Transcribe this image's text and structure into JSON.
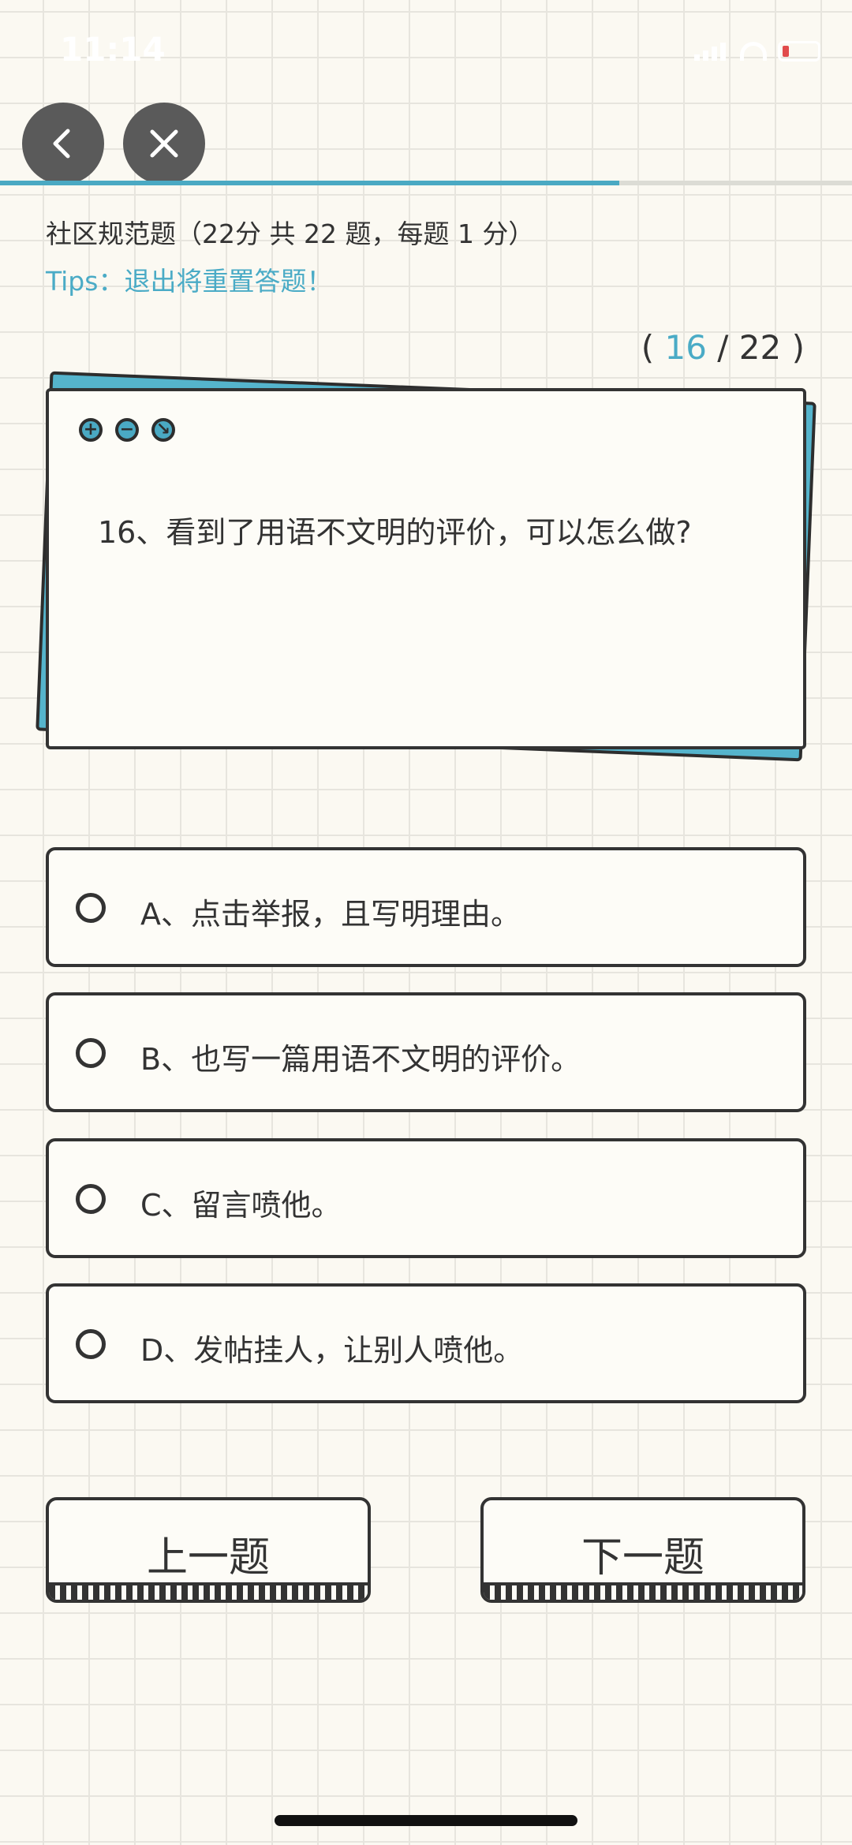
{
  "status_bar": {
    "time": "11:14"
  },
  "header": {
    "back_icon": "chevron-left-icon",
    "close_icon": "close-icon",
    "progress_fraction": 0.727
  },
  "quiz": {
    "section_title": "社区规范题（22分 共 22 题，每题 1 分）",
    "tips": "Tips：退出将重置答题！",
    "counter_open": "( ",
    "current": "16",
    "counter_sep": " / ",
    "total": "22",
    "counter_close": " )"
  },
  "question": {
    "text": "16、看到了用语不文明的评价，可以怎么做?"
  },
  "options": [
    {
      "label": "A、点击举报，且写明理由。"
    },
    {
      "label": "B、也写一篇用语不文明的评价。"
    },
    {
      "label": "C、留言喷他。"
    },
    {
      "label": "D、发帖挂人，让别人喷他。"
    }
  ],
  "navigation": {
    "prev_label": "上一题",
    "next_label": "下一题"
  },
  "colors": {
    "accent": "#4aabc6",
    "card_back": "#55b4cc",
    "border": "#333333",
    "background": "#fbf9f2"
  }
}
